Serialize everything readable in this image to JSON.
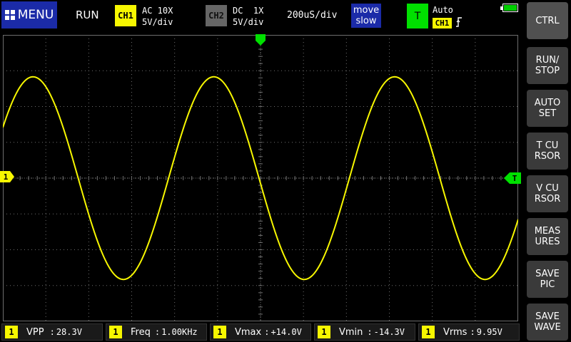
{
  "header": {
    "menu_label": "MENU",
    "run_status": "RUN",
    "ch1": {
      "badge": "CH1",
      "coupling": "AC 10X",
      "scale": "5V/div"
    },
    "ch2": {
      "badge": "CH2",
      "coupling": "DC  1X",
      "scale": "5V/div"
    },
    "timebase": "200uS/div",
    "move": {
      "line1": "move",
      "line2": "slow"
    },
    "trigger": {
      "badge": "T",
      "mode": "Auto",
      "source": "CH1",
      "edge_icon": "rising-edge-icon"
    },
    "battery_level": 1.0
  },
  "screen": {
    "ch1_marker": "1",
    "trigger_marker": "T",
    "grid_divisions": {
      "x": 12,
      "y": 8
    },
    "colors": {
      "trace": "#f7f700",
      "grid": "#6e6e6e",
      "trigger": "#00e000",
      "ch1": "#f7f700"
    },
    "waveform": {
      "type": "sine",
      "cycles_on_screen": 2.85,
      "amplitude_div": 2.83,
      "phase_deg": 30
    }
  },
  "sidebar": {
    "buttons": [
      {
        "id": "ctrl",
        "label": "CTRL"
      },
      {
        "id": "run-stop",
        "label": "RUN/\nSTOP"
      },
      {
        "id": "auto-set",
        "label": "AUTO\nSET"
      },
      {
        "id": "t-cursor",
        "label": "T CU\nRSOR"
      },
      {
        "id": "v-cursor",
        "label": "V CU\nRSOR"
      },
      {
        "id": "measures",
        "label": "MEAS\nURES"
      },
      {
        "id": "save-pic",
        "label": "SAVE\nPIC"
      },
      {
        "id": "save-wave",
        "label": "SAVE\nWAVE"
      }
    ]
  },
  "measurements": [
    {
      "channel": "1",
      "label": "VPP",
      "sep": ":",
      "value": "28.3V"
    },
    {
      "channel": "1",
      "label": "Freq",
      "sep": ":",
      "value": "1.00KHz"
    },
    {
      "channel": "1",
      "label": "Vmax",
      "sep": ":",
      "value": "+14.0V"
    },
    {
      "channel": "1",
      "label": "Vmin",
      "sep": ":",
      "value": "-14.3V"
    },
    {
      "channel": "1",
      "label": "Vrms",
      "sep": ":",
      "value": "9.95V"
    }
  ]
}
